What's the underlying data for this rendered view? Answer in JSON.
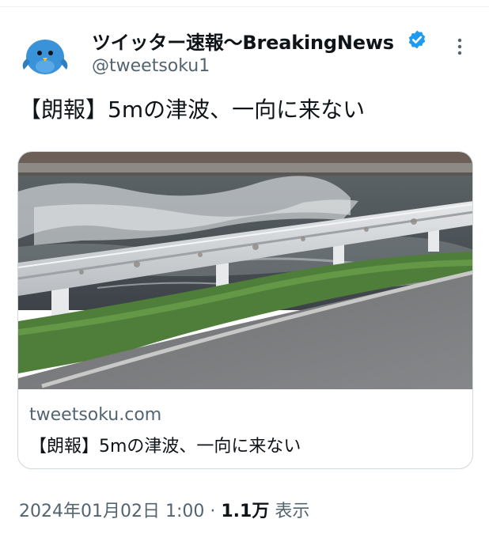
{
  "author": {
    "display_name": "ツイッター速報〜BreakingNews",
    "handle": "@tweetsoku1",
    "avatar_icon": "blue-bird-avatar-icon",
    "verified_icon": "verified-badge-icon",
    "verified_color": "#1d9bf0"
  },
  "tweet": {
    "text": "【朗報】5mの津波、一向に来ない"
  },
  "card": {
    "image_icon": "river-guardrail-photo",
    "domain": "tweetsoku.com",
    "title": "【朗報】5mの津波、一向に来ない"
  },
  "meta": {
    "timestamp": "2024年01月02日 1:00",
    "separator": " · ",
    "views_count": "1.1万",
    "views_label": " 表示"
  },
  "colors": {
    "text_primary": "#0f1419",
    "text_secondary": "#536471",
    "border": "#cfd9de"
  }
}
